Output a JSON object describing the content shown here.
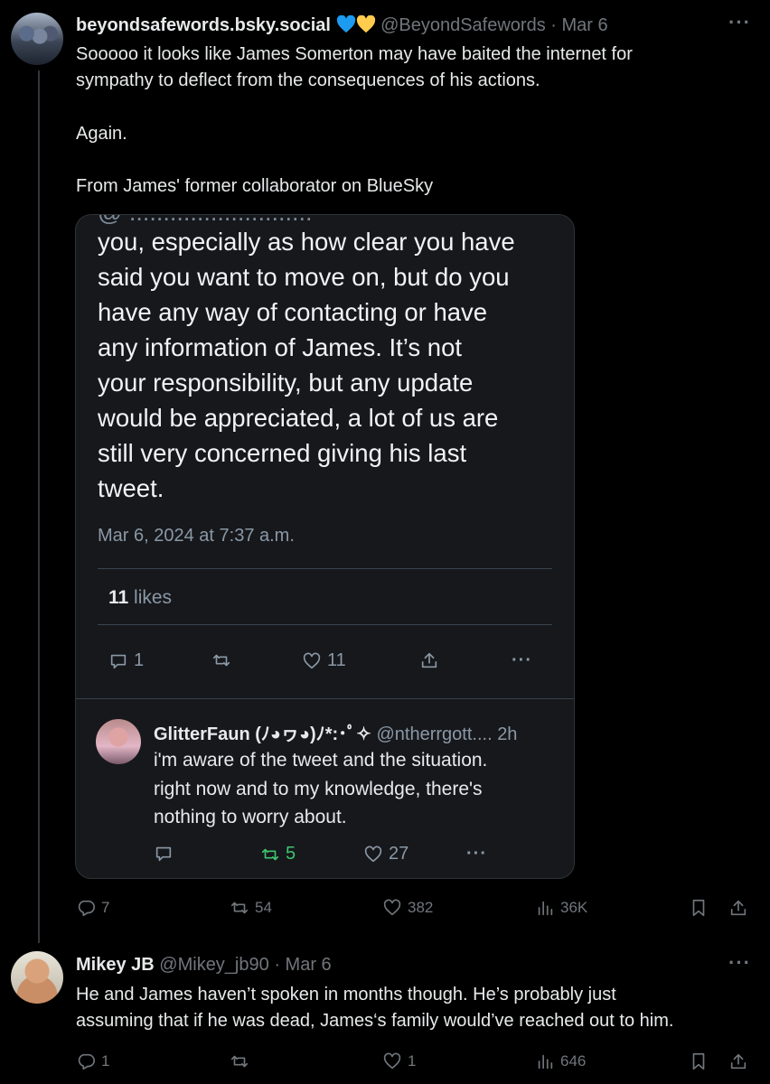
{
  "post": {
    "display_name": "beyondsafewords.bsky.social",
    "handle": "@BeyondSafewords",
    "date": "· Mar 6",
    "text_lines": [
      "Sooooo it looks like James Somerton may have baited the internet for",
      "sympathy to deflect from the consequences of his actions."
    ],
    "text_2": "Again.",
    "text_3": "From James' former collaborator on BlueSky",
    "actions": {
      "replies": "7",
      "reposts": "54",
      "likes": "382",
      "views": "36K"
    },
    "colors": {
      "heart_blue": "#1d9bf0",
      "heart_yellow": "#ffcc4d"
    }
  },
  "embed": {
    "cut_line": "@ ...........................",
    "body_lines": [
      "you, especially as how clear you have",
      "said you want to move on, but do you",
      "have any way of contacting or have",
      "any information of James. It’s not",
      "your responsibility, but any update",
      "would be appreciated, a lot of us are",
      "still very concerned giving his last",
      "tweet."
    ],
    "timestamp": "Mar 6, 2024 at 7:37 a.m.",
    "likes_count": "11",
    "likes_label": " likes",
    "actions": {
      "replies": "1",
      "reposts": "",
      "likes": "11"
    },
    "reply": {
      "name": "GlitterFaun (ﾉ◕ヮ◕)ﾉ*:･ﾟ✧",
      "handle": "@ntherrgott....",
      "time": "2h",
      "lines": [
        "i'm aware of the tweet and the situation.",
        "right now and to my knowledge, there's",
        "nothing to worry about."
      ],
      "actions": {
        "replies": "",
        "reposts": "5",
        "likes": "27"
      }
    }
  },
  "reply_post": {
    "display_name": "Mikey JB",
    "handle": "@Mikey_jb90",
    "date": "· Mar 6",
    "text_lines": [
      "He and James haven’t spoken in months though. He’s probably just",
      "assuming that if he was dead, James‘s family would’ve reached out to him."
    ],
    "actions": {
      "replies": "1",
      "reposts": "",
      "likes": "1",
      "views": "646"
    }
  },
  "icons": [
    "reply-icon",
    "repost-icon",
    "like-icon",
    "views-icon",
    "bookmark-icon",
    "share-icon",
    "more-icon",
    "upload-icon"
  ]
}
